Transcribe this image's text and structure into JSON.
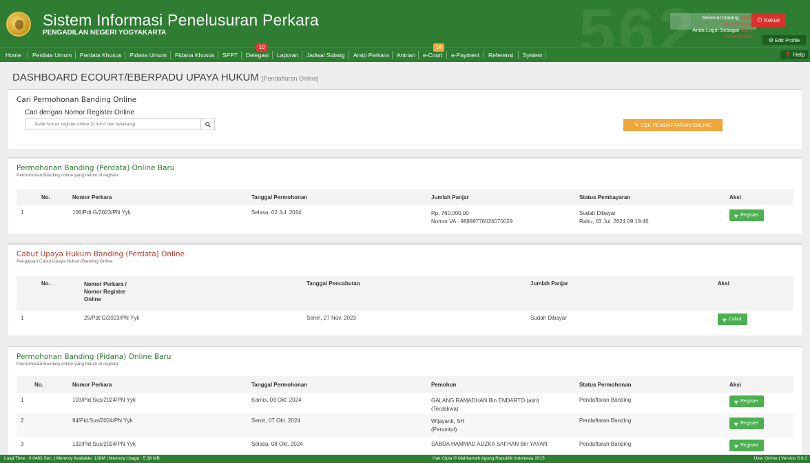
{
  "header": {
    "bg_number": "562",
    "title": "Sistem Informasi Penelusuran Perkara",
    "subtitle": "PENGADILAN NEGERI YOGYAKARTA",
    "welcome_line1": "Selamat Datang",
    "welcome_user": "Super Administrator",
    "welcome_line2": "Anda Login Sebagai",
    "welcome_role": "Super Administrator",
    "logout_label": "Keluar",
    "edit_profile_label": "Edit Profile"
  },
  "nav": {
    "items": [
      "Home",
      "Perdata Umum",
      "Perdata Khusus",
      "Pidana Umum",
      "Pidana Khusus",
      "SPPT",
      "Delegasi",
      "Laporan",
      "Jadwal Sidang",
      "Arsip Perkara",
      "Antrian",
      "e-Court",
      "e-Payment",
      "Referensi",
      "System"
    ],
    "delegasi_badge": "10",
    "ecourt_badge": "14",
    "help_label": "Help"
  },
  "page": {
    "title": "DASHBOARD ECOURT/EBERPADU UPAYA HUKUM",
    "title_tag": "[Pendaftaran Online]"
  },
  "search_panel": {
    "heading": "Cari Permohonan Banding Online",
    "label": "Cari dengan Nomor Register Online",
    "placeholder": "Ketik Nomor register online (3 huruf dari belakang)",
    "cek_button": "CEK PENDAFTARAN ONLINE"
  },
  "perdata_panel": {
    "heading": "Permohonan Banding (Perdata) Online Baru",
    "sub": "Permohonan Banding online yang belum di register",
    "columns": [
      "No.",
      "Nomor Perkara",
      "Tanggal Permohonan",
      "Jumlah Panjar",
      "Status Pembayaran",
      "Aksi"
    ],
    "rows": [
      {
        "no": "1",
        "nomor": "106/Pdt.G/2023/PN Yyk",
        "tanggal": "Selasa, 02 Jul. 2024",
        "panjar": "Rp. 760.000,00",
        "va": "Nomor VA : 98899776024070029",
        "status": "Sudah Dibayar",
        "status_date": "Rabu, 03 Jul. 2024 09:19:46",
        "aksi": "Register"
      }
    ]
  },
  "cabut_panel": {
    "heading": "Cabut Upaya Hukum Banding (Perdata) Online",
    "sub": "Pengajuan Cabut Upaya Hukum Banding Online",
    "columns": [
      "No.",
      "Nomor Perkara / Nomor Register Online",
      "Tanggal Pencabutan",
      "Jumlah Panjar",
      "Aksi"
    ],
    "col2_lines": [
      "Nomor Perkara /",
      "Nomor Register",
      "Online"
    ],
    "rows": [
      {
        "no": "1",
        "nomor": "25/Pdt.G/2023/PN Yyk",
        "tanggal": "Senin, 27 Nov. 2023",
        "panjar": "Sudah Dibayar",
        "aksi": "Cabut"
      }
    ]
  },
  "pidana_panel": {
    "heading": "Permohonan Banding (Pidana) Online Baru",
    "sub": "Permohonan Banding online yang belum di register",
    "columns": [
      "No.",
      "Nomor Perkara",
      "Tanggal Permohonan",
      "Pemohon",
      "Status Permohonan",
      "Aksi"
    ],
    "rows": [
      {
        "no": "1",
        "nomor": "103/Pid.Sus/2024/PN Yyk",
        "tanggal": "Kamis, 03 Okt. 2024",
        "pemohon": "GALANG RAMADHAN Bin ENDARTO (alm)",
        "peran": "(Terdakwa)",
        "status": "Pendaftaran Banding",
        "aksi": "Register"
      },
      {
        "no": "2",
        "nomor": "94/Pid.Sus/2024/PN Yyk",
        "tanggal": "Senin, 07 Okt. 2024",
        "pemohon": "Wijayanti, SH",
        "peran": "(Penuntut)",
        "status": "Pendaftaran Banding",
        "aksi": "Register"
      },
      {
        "no": "3",
        "nomor": "132/Pid.Sus/2024/PN Yyk",
        "tanggal": "Selasa, 08 Okt. 2024",
        "pemohon": "SABDA HAMMAD ADZKA SAFHAN Bin YAYAN",
        "peran": "",
        "status": "Pendaftaran Banding",
        "aksi": "Register"
      }
    ]
  },
  "footer": {
    "left": "Load Time : 0.0483 Sec. | Memory Available: 128M | Memory Usage : 5.38 MB",
    "center": "Hak Cipta © Mahkamah Agung Republik Indonesia 2015",
    "right": "User Online | Version 5.6.2"
  },
  "colors": {
    "header_green": "#2e7d32",
    "logout_red": "#d9322e",
    "cek_orange": "#f0a63a",
    "action_green": "#4caf50"
  }
}
